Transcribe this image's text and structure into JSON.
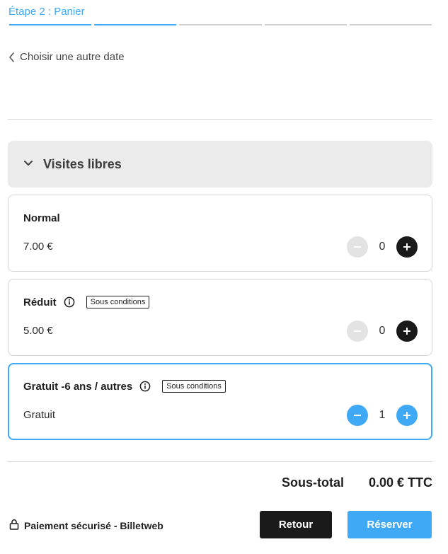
{
  "step": {
    "title": "Étape 2 : Panier",
    "segments": 5,
    "active_segments": 2
  },
  "back_link": {
    "label": "Choisir une autre date"
  },
  "category": {
    "label": "Visites libres"
  },
  "tickets": [
    {
      "name": "Normal",
      "price": "7.00 €",
      "quantity": "0",
      "conditions": null
    },
    {
      "name": "Réduit",
      "price": "5.00 €",
      "quantity": "0",
      "conditions": "Sous conditions"
    },
    {
      "name": "Gratuit -6 ans / autres",
      "price": "Gratuit",
      "quantity": "1",
      "conditions": "Sous conditions"
    }
  ],
  "subtotal": {
    "label": "Sous-total",
    "value": "0.00 € TTC"
  },
  "footer": {
    "secure_label": "Paiement sécurisé - Billetweb",
    "back_button": "Retour",
    "book_button": "Réserver"
  },
  "colors": {
    "accent": "#40a9f5",
    "dark": "#1a1a1a",
    "disabled": "#e3e3e3",
    "category_bg": "#ebebeb"
  }
}
